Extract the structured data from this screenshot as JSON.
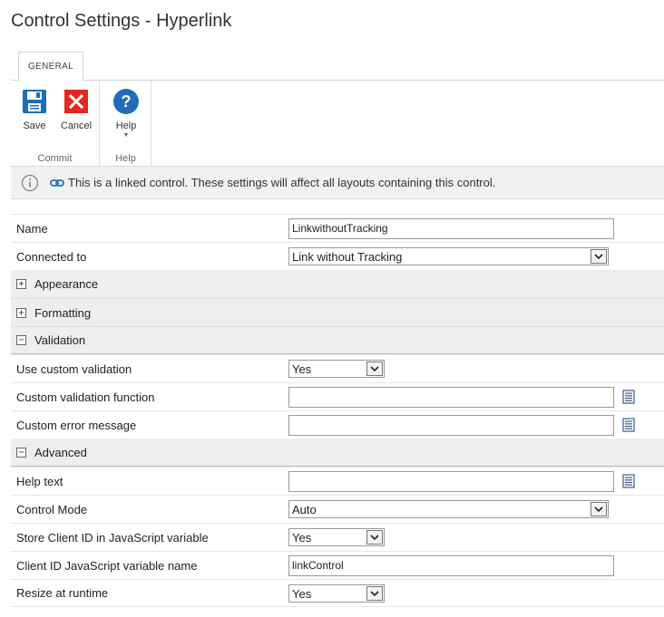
{
  "page": {
    "title": "Control Settings - Hyperlink"
  },
  "ribbon": {
    "tab": "GENERAL",
    "groups": {
      "commit": {
        "label": "Commit",
        "save": "Save",
        "cancel": "Cancel"
      },
      "help": {
        "label": "Help",
        "help": "Help"
      }
    }
  },
  "info": {
    "text": "This is a linked control. These settings will affect all layouts containing this control."
  },
  "fields": {
    "name": {
      "label": "Name",
      "value": "LinkwithoutTracking"
    },
    "connected_to": {
      "label": "Connected to",
      "value": "Link without Tracking"
    }
  },
  "sections": {
    "appearance": {
      "label": "Appearance",
      "state": "+"
    },
    "formatting": {
      "label": "Formatting",
      "state": "+"
    },
    "validation": {
      "label": "Validation",
      "state": "−"
    },
    "advanced": {
      "label": "Advanced",
      "state": "−"
    }
  },
  "validation": {
    "use_custom": {
      "label": "Use custom validation",
      "value": "Yes"
    },
    "custom_function": {
      "label": "Custom validation function",
      "value": ""
    },
    "custom_error": {
      "label": "Custom error message",
      "value": ""
    }
  },
  "advanced": {
    "help_text": {
      "label": "Help text",
      "value": ""
    },
    "control_mode": {
      "label": "Control Mode",
      "value": "Auto"
    },
    "store_client_id": {
      "label": "Store Client ID in JavaScript variable",
      "value": "Yes"
    },
    "client_id_var": {
      "label": "Client ID JavaScript variable name",
      "value": "linkControl"
    },
    "resize": {
      "label": "Resize at runtime",
      "value": "Yes"
    }
  },
  "colors": {
    "save_icon": "#1b6fb5",
    "cancel_icon": "#e3281f",
    "help_icon": "#1f6fb8",
    "link_icon": "#2a6ebb"
  }
}
